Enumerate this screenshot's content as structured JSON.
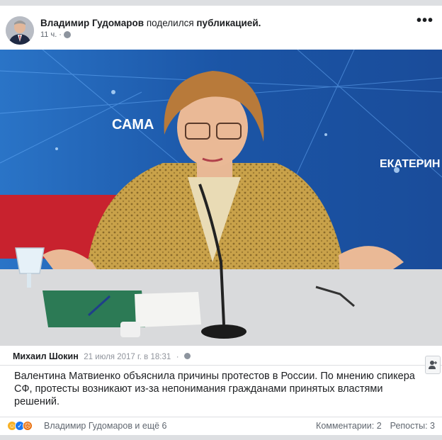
{
  "post": {
    "author": "Владимир Гудомаров",
    "share_text": "поделился",
    "share_target": "публикацией.",
    "timestamp": "11 ч.",
    "privacy_icon": "globe-icon",
    "more_icon": "more-icon",
    "more_label": "•••"
  },
  "image": {
    "backdrop_text_left": "САМА",
    "backdrop_text_right": "ЕКАТЕРИН",
    "colors": {
      "backdrop_blue": "#1d5fb0",
      "backdrop_red": "#c8222e",
      "table_gray": "#d9dadc",
      "jacket_gold": "#c9a24a"
    }
  },
  "shared": {
    "author": "Михаил Шокин",
    "date": "21 июля 2017 г. в 18:31",
    "separator": "·",
    "text": "Валентина Матвиенко объяснила причины протестов в России. По мнению спикера СФ, протесты возникают из-за непонимания гражданами принятых властями решений."
  },
  "footer": {
    "reactions": [
      "haha-icon",
      "like-icon",
      "angry-icon"
    ],
    "reactors": "Владимир Гудомаров и ещё 6",
    "comments": "Комментарии: 2",
    "reposts": "Репосты: 3"
  }
}
